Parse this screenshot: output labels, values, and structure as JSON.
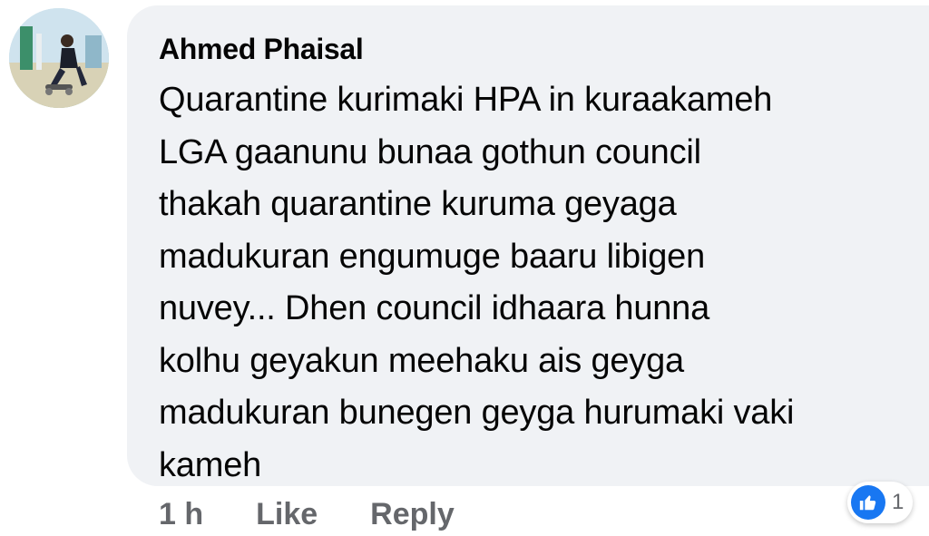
{
  "comment": {
    "author": "Ahmed Phaisal",
    "text": "Quarantine kurimaki HPA in kuraakameh\nLGA gaanunu bunaa gothun council\nthakah quarantine kuruma geyaga\nmadukuran engumuge baaru libigen\nnuvey...  Dhen council idhaara hunna\nkolhu geyakun meehaku ais geyga\nmadukuran bunegen geyga hurumaki vaki\nkameh",
    "timestamp": "1 h",
    "like_label": "Like",
    "reply_label": "Reply",
    "reactions": {
      "icon": "like-thumb-icon",
      "count": "1"
    }
  },
  "colors": {
    "bubble_background": "#f0f2f5",
    "text_primary": "#050505",
    "text_secondary": "#65676b",
    "like_blue": "#1877f2"
  }
}
